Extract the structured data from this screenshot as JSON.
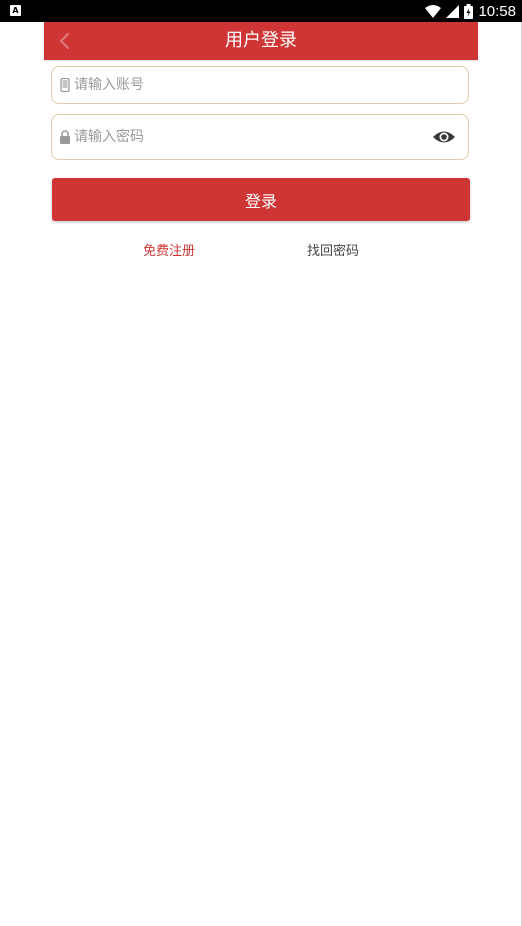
{
  "status_bar": {
    "app_badge": "A",
    "time": "10:58"
  },
  "header": {
    "title": "用户登录"
  },
  "form": {
    "account_placeholder": "请输入账号",
    "password_placeholder": "请输入密码",
    "login_label": "登录"
  },
  "links": {
    "register": "免费注册",
    "forgot_password": "找回密码"
  },
  "icons": {
    "back": "chevron-left-icon",
    "phone": "phone-icon",
    "lock": "lock-icon",
    "eye": "eye-icon",
    "wifi": "wifi-icon",
    "signal": "signal-icon",
    "battery": "battery-icon"
  },
  "colors": {
    "accent": "#d03535",
    "field_border": "#e2c7a8",
    "status_bar": "#000000"
  }
}
